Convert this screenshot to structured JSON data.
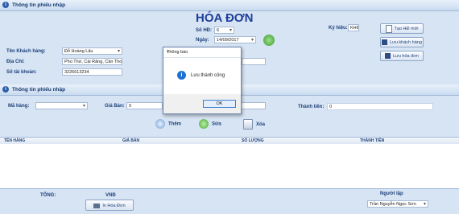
{
  "section_header_top": "Thông tin phiếu nhập",
  "invoice_title": "HÓA ĐƠN",
  "so_hd": {
    "label": "Số HĐ:",
    "value": "6"
  },
  "ngay": {
    "label": "Ngày:",
    "value": "14/09/2017"
  },
  "ky_hieu": {
    "label": "Ký hiệu:",
    "value": "KH6"
  },
  "customer": {
    "name_label": "Tên Khách hàng:",
    "name_value": "Đỗ Hoàng Lâu",
    "address_label": "Địa Chỉ:",
    "address_value": "Phú Thứ, Cái Răng, Cần Thơ",
    "account_label": "Số tài khoản:",
    "account_value": "3226613234"
  },
  "right_buttons": {
    "new": "Tạo HĐ mới",
    "save_customer": "Lưu khách hàng",
    "save_invoice": "Lưu hóa đơn"
  },
  "section_header_mid": "Thông tin phiếu nhập",
  "item": {
    "ma_hang_label": "Mã hàng:",
    "gia_ban_label": "Giá Bán:",
    "gia_ban_value": "0",
    "thanh_tien_label": "Thành tiền:",
    "thanh_tien_value": "0"
  },
  "actions": {
    "add": "Thêm",
    "edit": "Sửa",
    "delete": "Xóa"
  },
  "grid": {
    "columns": [
      "TÊN HÀNG",
      "GIÁ BÁN",
      "SỐ LƯỢNG",
      "THÀNH TIỀN"
    ]
  },
  "footer": {
    "total_label": "TỔNG:",
    "currency": "VNĐ",
    "print": "In Hóa Đơn",
    "creator_label": "Người lập",
    "creator_value": "Trần Nguyễn Ngọc Sơn"
  },
  "dialog": {
    "title": "Thông báo",
    "message": "Lưu thành công",
    "ok": "OK"
  }
}
